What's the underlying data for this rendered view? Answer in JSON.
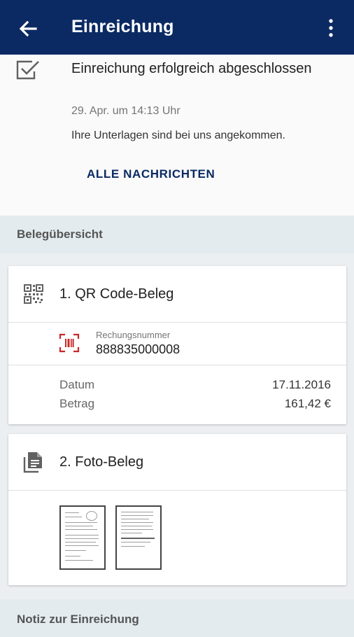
{
  "appbar": {
    "title": "Einreichung",
    "back_icon": "arrow-left-icon",
    "more_icon": "more-vert-icon"
  },
  "status": {
    "headline": "Einreichung erfolgreich abgeschlossen",
    "time": "29. Apr. um 14:13 Uhr",
    "message": "Ihre Unterlagen sind bei uns angekommen.",
    "all_messages": "ALLE NACHRICHTEN"
  },
  "sections": {
    "receipts": "Belegübersicht",
    "note": "Notiz zur Einreichung"
  },
  "qr_card": {
    "title": "1. QR Code-Beleg",
    "invoice_label": "Rechungsnummer",
    "invoice_number": "888835000008",
    "rows": [
      {
        "label": "Datum",
        "value": "17.11.2016"
      },
      {
        "label": "Betrag",
        "value": "161,42 €"
      }
    ]
  },
  "photo_card": {
    "title": "2. Foto-Beleg",
    "thumbnail_count": 2
  },
  "colors": {
    "primary": "#0b2a63",
    "accent_red": "#c62828",
    "section_bg": "#e3ebee"
  }
}
